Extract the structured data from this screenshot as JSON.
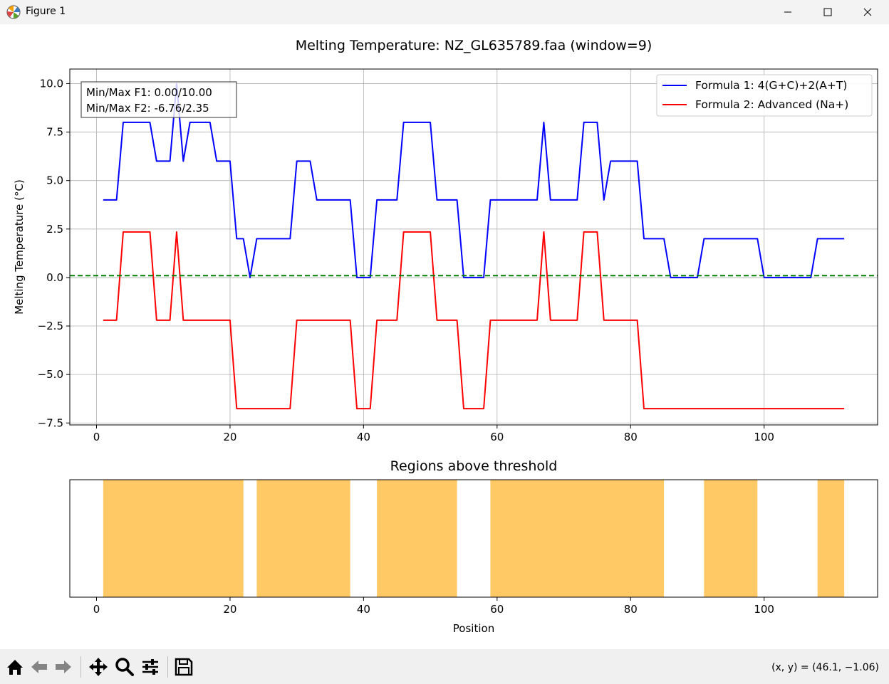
{
  "window": {
    "title": "Figure 1"
  },
  "chart_data": [
    {
      "type": "line",
      "title": "Melting Temperature: NZ_GL635789.faa (window=9)",
      "xlabel": "",
      "ylabel": "Melting Temperature (°C)",
      "xlim": [
        -4,
        117
      ],
      "ylim": [
        -7.6,
        10.75
      ],
      "xticks": [
        0,
        20,
        40,
        60,
        80,
        100
      ],
      "yticks": [
        -7.5,
        -5.0,
        -2.5,
        0.0,
        2.5,
        5.0,
        7.5,
        10.0
      ],
      "xtick_labels": [
        "0",
        "20",
        "40",
        "60",
        "80",
        "100"
      ],
      "ytick_labels": [
        "−7.5",
        "−5.0",
        "−2.5",
        "0.0",
        "2.5",
        "5.0",
        "7.5",
        "10.0"
      ],
      "grid": true,
      "legend_position": "top-right",
      "threshold_line": {
        "y": 0.1,
        "color": "#008000",
        "style": "dashed"
      },
      "annotation": [
        "Min/Max F1: 0.00/10.00",
        "Min/Max F2: -6.76/2.35"
      ],
      "series": [
        {
          "name": "Formula 1: 4(G+C)+2(A+T)",
          "color": "#0000ff",
          "x": [
            1,
            3,
            4,
            5,
            6,
            7,
            8,
            9,
            10,
            11,
            12,
            13,
            14,
            15,
            16,
            17,
            18,
            19,
            20,
            21,
            22,
            23,
            24,
            25,
            26,
            27,
            28,
            29,
            30,
            31,
            32,
            33,
            34,
            35,
            36,
            37,
            38,
            39,
            40,
            41,
            42,
            43,
            44,
            45,
            46,
            47,
            48,
            49,
            50,
            51,
            52,
            53,
            54,
            55,
            56,
            57,
            58,
            59,
            60,
            61,
            62,
            63,
            64,
            65,
            66,
            67,
            68,
            69,
            70,
            71,
            72,
            73,
            74,
            75,
            76,
            77,
            78,
            79,
            80,
            81,
            82,
            83,
            84,
            85,
            86,
            87,
            88,
            89,
            90,
            91,
            92,
            93,
            94,
            95,
            96,
            97,
            98,
            99,
            100,
            101,
            102,
            103,
            104,
            105,
            106,
            107,
            108,
            109,
            110,
            111,
            112
          ],
          "y": [
            4,
            4,
            8,
            8,
            8,
            8,
            8,
            6,
            6,
            6,
            10,
            6,
            8,
            8,
            8,
            8,
            6,
            6,
            6,
            2,
            2,
            0,
            2,
            2,
            2,
            2,
            2,
            2,
            6,
            6,
            6,
            4,
            4,
            4,
            4,
            4,
            4,
            0,
            0,
            0,
            4,
            4,
            4,
            4,
            8,
            8,
            8,
            8,
            8,
            4,
            4,
            4,
            4,
            0,
            0,
            0,
            0,
            4,
            4,
            4,
            4,
            4,
            4,
            4,
            4,
            8,
            4,
            4,
            4,
            4,
            4,
            8,
            8,
            8,
            4,
            6,
            6,
            6,
            6,
            6,
            2,
            2,
            2,
            2,
            0,
            0,
            0,
            0,
            0,
            2,
            2,
            2,
            2,
            2,
            2,
            2,
            2,
            2,
            0,
            0,
            0,
            0,
            0,
            0,
            0,
            0,
            2,
            2,
            2,
            2,
            2
          ]
        },
        {
          "name": "Formula 2: Advanced (Na+)",
          "color": "#ff0000",
          "x": [
            1,
            3,
            4,
            5,
            6,
            7,
            8,
            9,
            10,
            11,
            12,
            13,
            14,
            15,
            16,
            17,
            18,
            19,
            20,
            21,
            22,
            23,
            24,
            25,
            26,
            27,
            28,
            29,
            30,
            31,
            32,
            33,
            34,
            35,
            36,
            37,
            38,
            39,
            40,
            41,
            42,
            43,
            44,
            45,
            46,
            47,
            48,
            49,
            50,
            51,
            52,
            53,
            54,
            55,
            56,
            57,
            58,
            59,
            60,
            61,
            62,
            63,
            64,
            65,
            66,
            67,
            68,
            69,
            70,
            71,
            72,
            73,
            74,
            75,
            76,
            77,
            78,
            79,
            80,
            81,
            82,
            83,
            112
          ],
          "y": [
            -2.2,
            -2.2,
            2.35,
            2.35,
            2.35,
            2.35,
            2.35,
            -2.2,
            -2.2,
            -2.2,
            2.35,
            -2.2,
            -2.2,
            -2.2,
            -2.2,
            -2.2,
            -2.2,
            -2.2,
            -2.2,
            -6.76,
            -6.76,
            -6.76,
            -6.76,
            -6.76,
            -6.76,
            -6.76,
            -6.76,
            -6.76,
            -2.2,
            -2.2,
            -2.2,
            -2.2,
            -2.2,
            -2.2,
            -2.2,
            -2.2,
            -2.2,
            -6.76,
            -6.76,
            -6.76,
            -2.2,
            -2.2,
            -2.2,
            -2.2,
            2.35,
            2.35,
            2.35,
            2.35,
            2.35,
            -2.2,
            -2.2,
            -2.2,
            -2.2,
            -6.76,
            -6.76,
            -6.76,
            -6.76,
            -2.2,
            -2.2,
            -2.2,
            -2.2,
            -2.2,
            -2.2,
            -2.2,
            -2.2,
            2.35,
            -2.2,
            -2.2,
            -2.2,
            -2.2,
            -2.2,
            2.35,
            2.35,
            2.35,
            -2.2,
            -2.2,
            -2.2,
            -2.2,
            -2.2,
            -2.2,
            -6.76,
            -6.76,
            -6.76
          ]
        }
      ]
    },
    {
      "type": "area",
      "title": "Regions above threshold",
      "xlabel": "Position",
      "ylabel": "",
      "xlim": [
        -4,
        117
      ],
      "xticks": [
        0,
        20,
        40,
        60,
        80,
        100
      ],
      "xtick_labels": [
        "0",
        "20",
        "40",
        "60",
        "80",
        "100"
      ],
      "grid": false,
      "fill_color": "#ffa500",
      "regions": [
        [
          1,
          22
        ],
        [
          24,
          38
        ],
        [
          42,
          54
        ],
        [
          59,
          85
        ],
        [
          91,
          99
        ],
        [
          108,
          112
        ]
      ]
    }
  ],
  "toolbar": {
    "icons": [
      "home-icon",
      "back-arrow-icon",
      "forward-arrow-icon",
      "pan-icon",
      "zoom-icon",
      "configure-subplots-icon",
      "save-icon"
    ],
    "coords_text": "(x, y) = (46.1, −1.06)"
  }
}
